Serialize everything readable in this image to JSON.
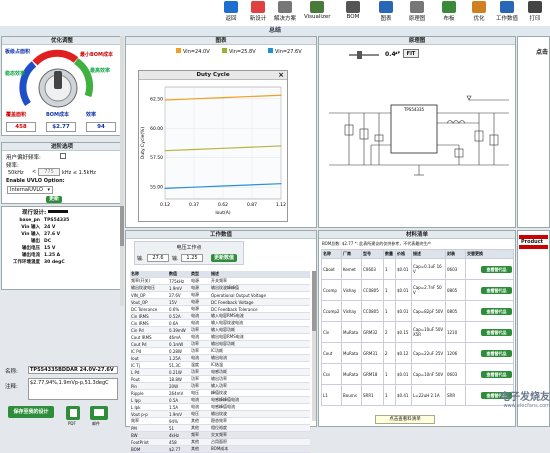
{
  "toolbar": {
    "items": [
      {
        "label": "返回",
        "icon": "back-arrow-icon",
        "color": "#1e6fd0"
      },
      {
        "label": "新设计",
        "icon": "refresh-icon",
        "color": "#e04040"
      },
      {
        "label": "解决方案",
        "icon": "solution-icon",
        "color": "#777"
      },
      {
        "label": "Visualizer",
        "icon": "visualizer-icon",
        "color": "#4a7a3a"
      },
      {
        "label": "BOM",
        "icon": "bom-icon",
        "color": "#555"
      },
      {
        "label": "图表",
        "icon": "chart-icon",
        "color": "#2a66b8"
      },
      {
        "label": "原理图",
        "icon": "schematic-icon",
        "color": "#777"
      },
      {
        "label": "布板",
        "icon": "layout-icon",
        "color": "#3a8a3a"
      },
      {
        "label": "优化",
        "icon": "optimize-icon",
        "color": "#d08020"
      },
      {
        "label": "工作数值",
        "icon": "values-icon",
        "color": "#2a66b8"
      },
      {
        "label": "打印",
        "icon": "print-icon",
        "color": "#444"
      }
    ]
  },
  "summary_title": "总结",
  "optimize": {
    "title": "优化调整",
    "knob_labels": {
      "small_area": "板级占面积",
      "efficiency": "稳态效率",
      "bom_cost": "最小BOM成本",
      "high_freq": "最高效率"
    },
    "metrics": [
      {
        "label": "覆盖面积",
        "value": "458"
      },
      {
        "label": "BOM成本",
        "value": "$2.77"
      },
      {
        "label": "效率",
        "value": "94"
      }
    ]
  },
  "advanced": {
    "title": "进阶选项",
    "user_freq": "用户偏好频率:",
    "freq_label": "频率:",
    "freq_min": "50kHz",
    "freq_value": "775",
    "freq_max": "kHz ≤ 1.5kHz",
    "uvlo_label": "Enable UVLO Option:",
    "uvlo_value": "InternalUVLO",
    "update_btn": "更新"
  },
  "design": {
    "title": "现行设计:",
    "rows": [
      [
        "base_pn",
        "TPS54335"
      ],
      [
        "Vin 输入",
        "24 V"
      ],
      [
        "Vin 输入",
        "27.6 V"
      ],
      [
        "输出",
        "DC"
      ],
      [
        "输出电压",
        "15 V"
      ],
      [
        "输出电流",
        "1.25 A"
      ],
      [
        "工作环境温度",
        "30 degC"
      ]
    ]
  },
  "name": {
    "label": "名称:",
    "value": "TPS54335BDDAR 24.0V-27.6V",
    "note_label": "注释:",
    "note_value": "$2.77,94%,1.9mVp-p,51.3degC"
  },
  "bottom": {
    "save_btn": "保存至我的设计",
    "pdf_btn": "PDF",
    "mail_btn": "邮件"
  },
  "chart_panel": {
    "title": "图表",
    "legend": [
      "Vin=24.0V",
      "Vin=25.8V",
      "Vin=27.6V"
    ],
    "legend_colors": [
      "#f0a020",
      "#9bb030",
      "#2090d0"
    ]
  },
  "chart_data": {
    "type": "line",
    "title": "Duty Cycle",
    "xlabel": "Iout(A)",
    "ylabel": "Duty Cycle(%)",
    "x": [
      0.12,
      0.37,
      0.62,
      0.87,
      1.12
    ],
    "xticks": [
      "0.12",
      "0.37",
      "0.62",
      "0.87",
      "1.12"
    ],
    "yticks": [
      "55.00",
      "57.50",
      "60.00",
      "62.50"
    ],
    "ylim": [
      54.0,
      63.5
    ],
    "series": [
      {
        "name": "Vin=24.0V",
        "color": "#f0a020",
        "values": [
          62.4,
          62.5,
          62.6,
          62.7,
          62.8
        ]
      },
      {
        "name": "Vin=25.8V",
        "color": "#b7b540",
        "values": [
          58.1,
          58.2,
          58.3,
          58.4,
          58.5
        ]
      },
      {
        "name": "Vin=27.6V",
        "color": "#2a8fd8",
        "values": [
          54.9,
          55.0,
          55.1,
          55.2,
          55.3
        ]
      }
    ]
  },
  "schematic": {
    "title": "原理图",
    "zoom": "0.4",
    "fit": "FIT",
    "ic_label": "TPS54335"
  },
  "right_edge": {
    "label": "点击"
  },
  "work": {
    "title": "工作数值",
    "sub": "电压工作点",
    "v1": "27.6",
    "v2": "1.25",
    "update": "更新数值",
    "headers": [
      "名称",
      "数值",
      "类型",
      "描述"
    ],
    "rows": [
      [
        "频率(开关)",
        "775kHz",
        "电源",
        "开关频率"
      ],
      [
        "输出纹波电压",
        "1.9mV",
        "电源",
        "输出纹波峰峰值"
      ],
      [
        "VIN_OP",
        "27.6V",
        "电源",
        "Operational Output Voltage"
      ],
      [
        "Vout_OP",
        "15V",
        "电源",
        "DC Feedback Voltage"
      ],
      [
        "DC Tolerance",
        "0.6%",
        "电源",
        "DC Feedback Tolerance"
      ],
      [
        "Cin IRMS",
        "0.52A",
        "电流",
        "输入电容RMS电流"
      ],
      [
        "Cin IRMS",
        "0.6A",
        "电流",
        "输入电容纹波电流"
      ],
      [
        "Cin Pd",
        "0.39mW",
        "功率",
        "输入电容功耗"
      ],
      [
        "Cout IRMS",
        "46mA",
        "电流",
        "输出电容RMS电流"
      ],
      [
        "Cout Pd",
        "0.1mW",
        "功率",
        "输出电容功耗"
      ],
      [
        "IC Pd",
        "0.28W",
        "功率",
        "IC功耗"
      ],
      [
        "Iout",
        "1.25A",
        "电流",
        "输出电流"
      ],
      [
        "IC Tj",
        "51.3C",
        "温度",
        "IC结温"
      ],
      [
        "L Pd",
        "0.21W",
        "功率",
        "电感功耗"
      ],
      [
        "Pout",
        "18.8W",
        "功率",
        "输出功率"
      ],
      [
        "Pin",
        "20W",
        "功率",
        "输入功率"
      ],
      [
        "Ripple",
        "264mV",
        "电压",
        "峰值纹波"
      ],
      [
        "L Ipp",
        "0.5A",
        "电流",
        "电感峰峰值电流"
      ],
      [
        "L Ipk",
        "1.5A",
        "电流",
        "电感峰值电流"
      ],
      [
        "Vout p-p",
        "1.9mV",
        "电压",
        "输出纹波"
      ],
      [
        "效率",
        "94%",
        "其他",
        "稳态效率"
      ],
      [
        "PM",
        "51",
        "其他",
        "相位裕度"
      ],
      [
        "BW",
        "4kHz",
        "频率",
        "交叉频率"
      ],
      [
        "FootPrint",
        "458",
        "其他",
        "占用面积"
      ],
      [
        "BOM",
        "$2.77",
        "其他",
        "BOM成本"
      ]
    ]
  },
  "bom": {
    "title": "材料清单",
    "summary": "BOM总数: $2.77  *: 此表所建议的仅供参考，不代表最终生产",
    "headers": [
      "名称",
      "厂商",
      "型号",
      "数量",
      "价格",
      "描述",
      "封装",
      "交替更换"
    ],
    "alt_btn": "查看替代品",
    "rows": [
      [
        "Cboot",
        "Kemet",
        "C0603",
        "1",
        "$0.01",
        "Cap=0.1uF 16V",
        "0603"
      ],
      [
        "Ccomp",
        "Vishay",
        "CC0805",
        "1",
        "$0.01",
        "Cap=2.7nF 50V",
        "0805"
      ],
      [
        "Ccomp2",
        "Vishay",
        "CC0805",
        "1",
        "$0.01",
        "Cap=82pF 50V",
        "0805"
      ],
      [
        "Cin",
        "MuRata",
        "GRM32",
        "2",
        "$0.15",
        "Cap=10uF 50V X5R",
        "1210"
      ],
      [
        "Cout",
        "MuRata",
        "GRM31",
        "2",
        "$0.12",
        "Cap=22uF 25V",
        "1206"
      ],
      [
        "Css",
        "MuRata",
        "GRM18",
        "1",
        "$0.01",
        "Cap=10nF 50V",
        "0603"
      ],
      [
        "L1",
        "Bourns",
        "SRR1",
        "1",
        "$0.41",
        "L=22uH 2.1A",
        "SRR"
      ]
    ]
  },
  "product_panel": {
    "label": "Product"
  },
  "tooltip": {
    "text": "点击查看料清单"
  },
  "watermark": {
    "line1": "电子发烧友",
    "line2": "www.elecfans.com"
  }
}
